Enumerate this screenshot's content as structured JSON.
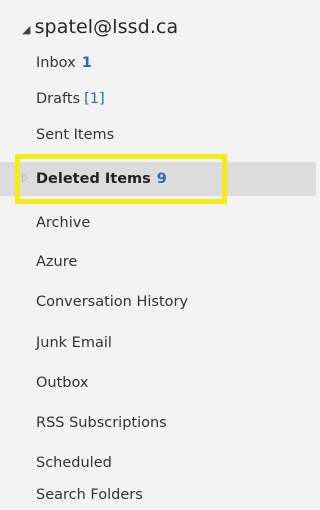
{
  "account": {
    "caret_icon": "triangle-down-icon",
    "name": "spatel@lssd.ca"
  },
  "folders": [
    {
      "label": "Inbox",
      "count": "1"
    },
    {
      "label": "Drafts",
      "count": "[1]"
    },
    {
      "label": "Sent Items",
      "count": ""
    },
    {
      "label": "Deleted Items",
      "count": "9",
      "selected": true,
      "expandable": true
    },
    {
      "label": "Archive",
      "count": ""
    },
    {
      "label": "Azure",
      "count": ""
    },
    {
      "label": "Conversation History",
      "count": ""
    },
    {
      "label": "Junk Email",
      "count": ""
    },
    {
      "label": "Outbox",
      "count": ""
    },
    {
      "label": "RSS Subscriptions",
      "count": ""
    },
    {
      "label": "Scheduled",
      "count": ""
    },
    {
      "label": "Search Folders",
      "count": ""
    }
  ],
  "colors": {
    "unread_count": "#2a6ab1",
    "selected_background": "#dcdcdc",
    "highlight_box": "#f3ec19"
  }
}
